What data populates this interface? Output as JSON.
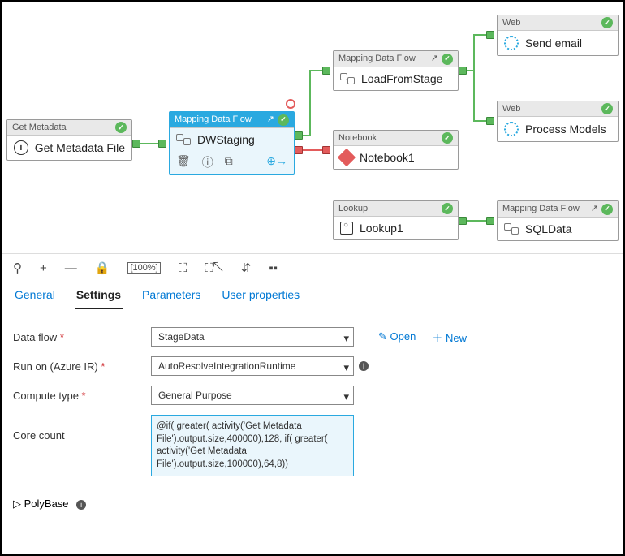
{
  "nodes": {
    "getmeta": {
      "type": "Get Metadata",
      "label": "Get Metadata File"
    },
    "dwstaging": {
      "type": "Mapping Data Flow",
      "label": "DWStaging"
    },
    "loadstage": {
      "type": "Mapping Data Flow",
      "label": "LoadFromStage"
    },
    "notebook": {
      "type": "Notebook",
      "label": "Notebook1"
    },
    "sendmail": {
      "type": "Web",
      "label": "Send email"
    },
    "procmodel": {
      "type": "Web",
      "label": "Process Models"
    },
    "lookup": {
      "type": "Lookup",
      "label": "Lookup1"
    },
    "sqldata": {
      "type": "Mapping Data Flow",
      "label": "SQLData"
    }
  },
  "toolbar": {
    "search": "⚲",
    "add": "+",
    "remove": "—",
    "lock": "🔒",
    "pct": "[100%]",
    "fit": "⛶",
    "select": "⛶↖",
    "layout": "⇵",
    "view": "▪▪"
  },
  "tabs": {
    "general": "General",
    "settings": "Settings",
    "parameters": "Parameters",
    "user": "User properties"
  },
  "form": {
    "dataflow": {
      "label": "Data flow",
      "value": "StageData",
      "open": "Open",
      "new": "New"
    },
    "runon": {
      "label": "Run on (Azure IR)",
      "value": "AutoResolveIntegrationRuntime"
    },
    "compute": {
      "label": "Compute type",
      "value": "General Purpose"
    },
    "corecount": {
      "label": "Core count",
      "value": "@if( greater( activity('Get Metadata File').output.size,400000),128, if( greater( activity('Get Metadata File').output.size,100000),64,8))"
    },
    "polybase": "PolyBase"
  }
}
